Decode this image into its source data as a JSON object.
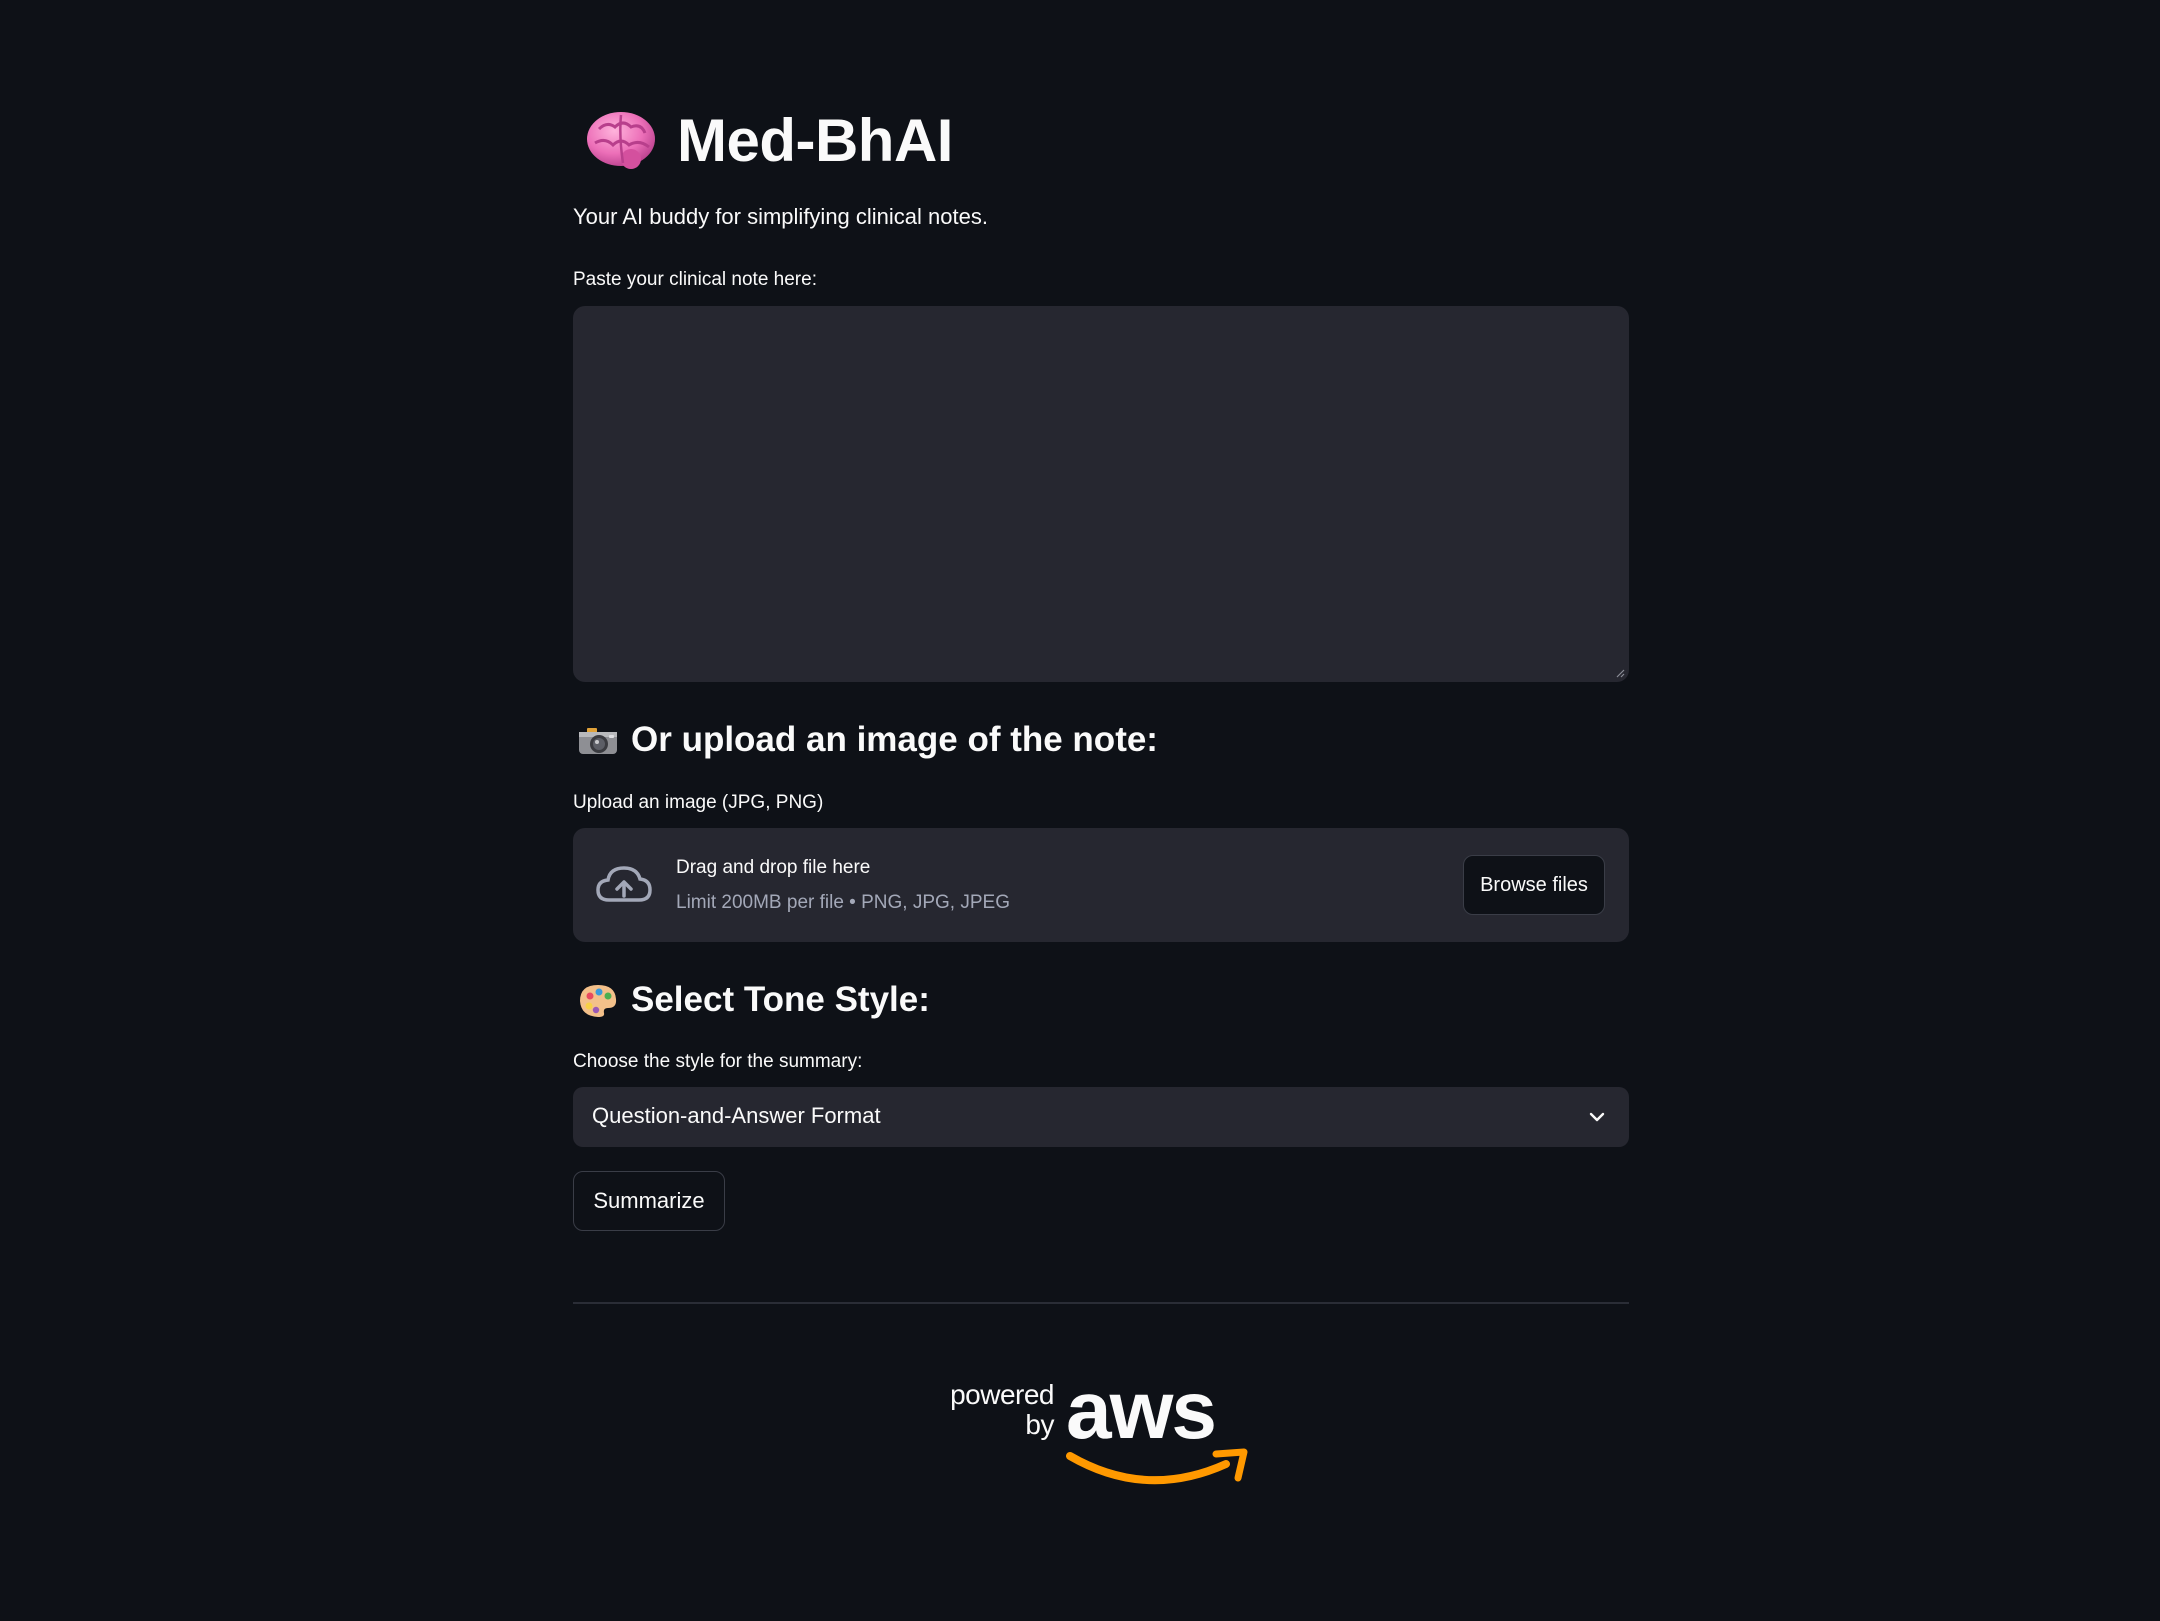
{
  "app": {
    "title": "Med-BhAI",
    "subtitle": "Your AI buddy for simplifying clinical notes.",
    "icon": "brain-icon"
  },
  "note_input": {
    "label": "Paste your clinical note here:",
    "value": "",
    "placeholder": ""
  },
  "upload_section": {
    "heading": "Or upload an image of the note:",
    "icon": "camera-icon",
    "label": "Upload an image (JPG, PNG)",
    "drop_title": "Drag and drop file here",
    "drop_limit": "Limit 200MB per file • PNG, JPG, JPEG",
    "browse_label": "Browse files"
  },
  "tone_section": {
    "heading": "Select Tone Style:",
    "icon": "palette-icon",
    "label": "Choose the style for the summary:",
    "selected": "Question-and-Answer Format"
  },
  "actions": {
    "summarize_label": "Summarize"
  },
  "footer": {
    "powered_line1": "powered",
    "powered_line2": "by",
    "brand": "aws",
    "smile_color": "#f90"
  },
  "colors": {
    "background": "#0e1117",
    "surface": "#262730",
    "text": "#fafafa",
    "muted": "#a3a8b8",
    "brain_pink": "#ec6fb8"
  }
}
